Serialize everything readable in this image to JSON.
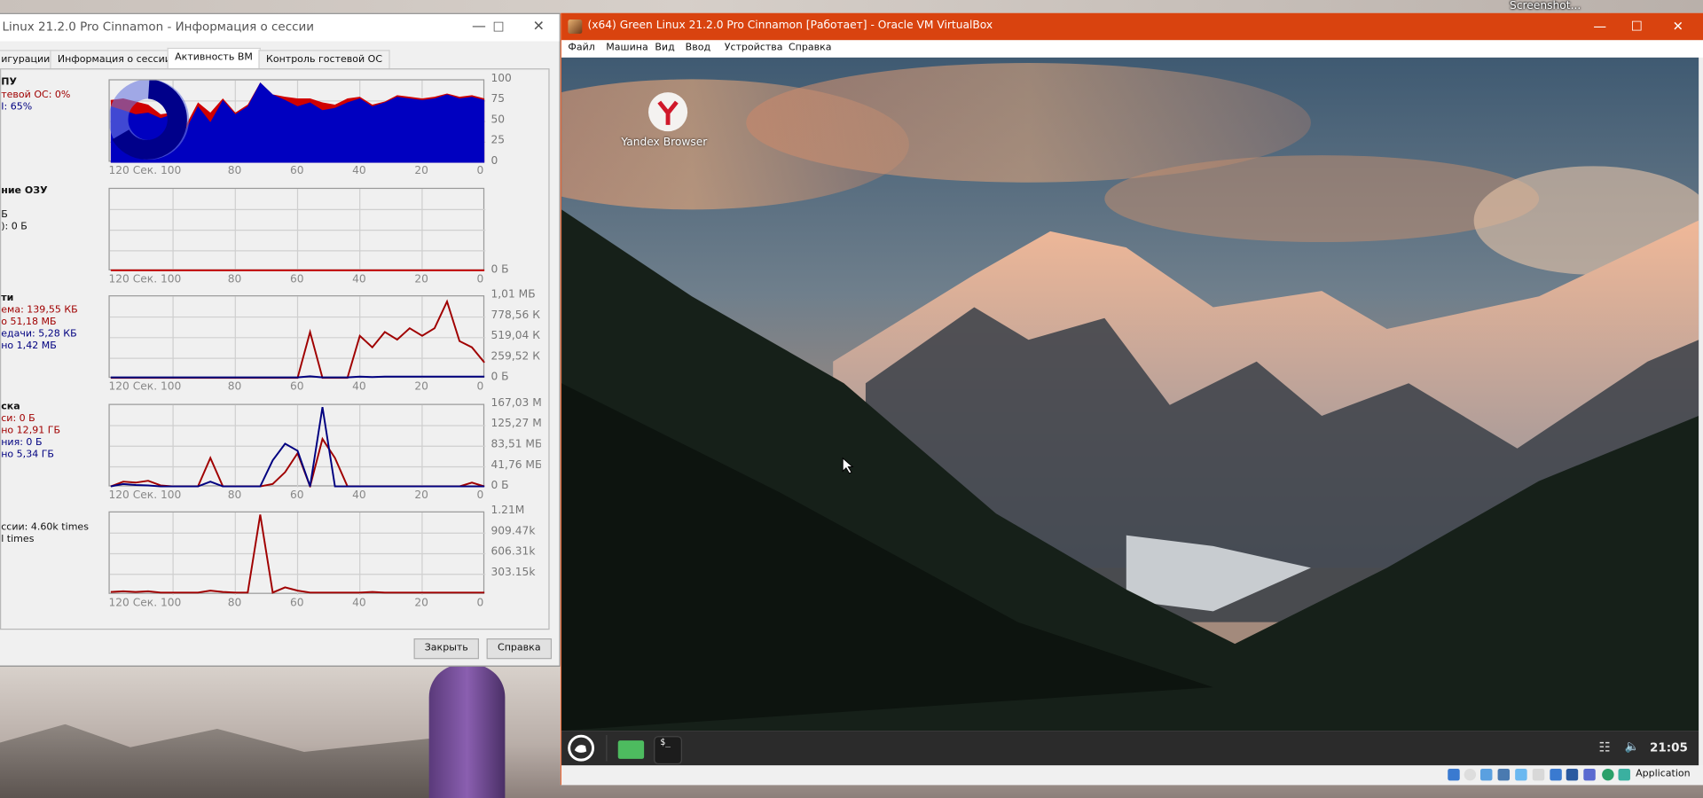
{
  "desktop": {
    "screenshot_label": "Screenshot..."
  },
  "dialog": {
    "title": "Linux 21.2.0 Pro Cinnamon - Информация о сессии",
    "tabs": [
      {
        "label": "игурации",
        "active": false
      },
      {
        "label": "Информация о сессии",
        "active": false
      },
      {
        "label": "Активность ВМ",
        "active": true
      },
      {
        "label": "Контроль гостевой ОС",
        "active": false
      }
    ],
    "sections": [
      {
        "heading": "ПУ",
        "lines": [
          {
            "text": "тевой ОС: 0%",
            "color": "#a00000"
          },
          {
            "text": "І: 65%",
            "color": "#000080"
          }
        ]
      },
      {
        "heading": "ние ОЗУ",
        "lines": [
          {
            "text": "Б",
            "color": "#111111"
          },
          {
            "text": "): 0 Б",
            "color": "#111111"
          }
        ]
      },
      {
        "heading": "ти",
        "lines": [
          {
            "text": "ема: 139,55 КБ",
            "color": "#a00000"
          },
          {
            "text": "о 51,18 МБ",
            "color": "#a00000"
          },
          {
            "text": "едачи: 5,28 КБ",
            "color": "#000080"
          },
          {
            "text": "но 1,42 МБ",
            "color": "#000080"
          }
        ]
      },
      {
        "heading": "ска",
        "lines": [
          {
            "text": "си: 0 Б",
            "color": "#a00000"
          },
          {
            "text": "но 12,91 ГБ",
            "color": "#a00000"
          },
          {
            "text": "ния: 0 Б",
            "color": "#000080"
          },
          {
            "text": "но 5,34 ГБ",
            "color": "#000080"
          }
        ]
      },
      {
        "heading": "",
        "lines": [
          {
            "text": "ссии: 4.60k times",
            "color": "#111111"
          },
          {
            "text": "l times",
            "color": "#111111"
          }
        ]
      }
    ],
    "close_label": "Закрыть",
    "help_label": "Справка"
  },
  "chart_data": [
    {
      "type": "area",
      "xlim": [
        120,
        0
      ],
      "ylim": [
        0,
        100
      ],
      "grid": true,
      "x": [
        120,
        116,
        112,
        108,
        104,
        100,
        96,
        92,
        88,
        84,
        80,
        76,
        72,
        68,
        64,
        60,
        56,
        52,
        48,
        44,
        40,
        36,
        32,
        28,
        24,
        20,
        16,
        12,
        8,
        4,
        0
      ],
      "x_ticks": [
        "120 Сек. 100",
        "80",
        "60",
        "40",
        "20",
        "0"
      ],
      "y_ticks": [
        "100",
        "75",
        "50",
        "25",
        "0"
      ],
      "series": [
        {
          "color": "#d00000",
          "values": [
            78,
            80,
            76,
            72,
            60,
            62,
            45,
            75,
            62,
            80,
            62,
            72,
            100,
            85,
            82,
            80,
            80,
            75,
            72,
            80,
            82,
            72,
            76,
            84,
            82,
            80,
            82,
            86,
            82,
            84,
            80
          ]
        },
        {
          "color": "#0000c0",
          "values": [
            70,
            65,
            60,
            62,
            55,
            60,
            40,
            70,
            50,
            78,
            60,
            70,
            100,
            85,
            78,
            70,
            75,
            65,
            68,
            75,
            80,
            70,
            75,
            82,
            80,
            78,
            80,
            85,
            80,
            82,
            78
          ]
        }
      ]
    },
    {
      "type": "line",
      "xlim": [
        120,
        0
      ],
      "ylim": [
        0,
        1
      ],
      "grid": true,
      "x": [
        120,
        0
      ],
      "x_ticks": [
        "120 Сек. 100",
        "80",
        "60",
        "40",
        "20",
        "0"
      ],
      "y_ticks": [
        "0 Б"
      ],
      "series": [
        {
          "color": "#c00000",
          "values": [
            0,
            0
          ]
        }
      ]
    },
    {
      "type": "line",
      "xlim": [
        120,
        0
      ],
      "ylim": [
        0,
        1038
      ],
      "grid": true,
      "x": [
        120,
        116,
        112,
        108,
        104,
        100,
        96,
        92,
        88,
        84,
        80,
        76,
        72,
        68,
        64,
        60,
        56,
        52,
        48,
        44,
        40,
        36,
        32,
        28,
        24,
        20,
        16,
        12,
        8,
        4,
        0
      ],
      "x_ticks": [
        "120 Сек. 100",
        "80",
        "60",
        "40",
        "20",
        "0"
      ],
      "y_ticks": [
        "1,01 МБ",
        "778,56 К",
        "519,04 К",
        "259,52 К",
        "0 Б"
      ],
      "series": [
        {
          "color": "#a00000",
          "values": [
            0,
            0,
            0,
            0,
            0,
            0,
            0,
            0,
            0,
            0,
            0,
            0,
            0,
            0,
            0,
            0,
            600,
            0,
            0,
            0,
            550,
            400,
            600,
            500,
            650,
            550,
            650,
            1000,
            480,
            400,
            200
          ]
        },
        {
          "color": "#000080",
          "values": [
            5,
            5,
            5,
            5,
            5,
            5,
            5,
            5,
            5,
            5,
            5,
            5,
            5,
            5,
            5,
            5,
            20,
            5,
            5,
            5,
            15,
            10,
            15,
            15,
            15,
            15,
            15,
            15,
            15,
            15,
            15
          ]
        }
      ]
    },
    {
      "type": "line",
      "xlim": [
        120,
        0
      ],
      "ylim": [
        0,
        167.03
      ],
      "grid": true,
      "x": [
        120,
        116,
        112,
        108,
        104,
        100,
        96,
        92,
        88,
        84,
        80,
        76,
        72,
        68,
        64,
        60,
        56,
        52,
        48,
        44,
        40,
        36,
        32,
        28,
        24,
        20,
        16,
        12,
        8,
        4,
        0
      ],
      "x_ticks": [
        "120 Сек. 100",
        "80",
        "60",
        "40",
        "20",
        "0"
      ],
      "y_ticks": [
        "167,03 М",
        "125,27 М",
        "83,51 МБ",
        "41,76 МБ",
        "0 Б"
      ],
      "series": [
        {
          "color": "#a00000",
          "values": [
            0,
            10,
            8,
            12,
            2,
            0,
            0,
            0,
            60,
            0,
            0,
            0,
            0,
            5,
            30,
            70,
            0,
            100,
            60,
            0,
            0,
            0,
            0,
            0,
            0,
            0,
            0,
            0,
            0,
            8,
            0
          ]
        },
        {
          "color": "#000080",
          "values": [
            0,
            5,
            3,
            2,
            0,
            0,
            0,
            0,
            10,
            0,
            0,
            0,
            0,
            55,
            90,
            75,
            0,
            167,
            0,
            0,
            0,
            0,
            0,
            0,
            0,
            0,
            0,
            0,
            0,
            0,
            0
          ]
        }
      ]
    },
    {
      "type": "line",
      "xlim": [
        120,
        0
      ],
      "ylim": [
        0,
        1210
      ],
      "grid": true,
      "x": [
        120,
        116,
        112,
        108,
        104,
        100,
        96,
        92,
        88,
        84,
        80,
        76,
        72,
        68,
        64,
        60,
        56,
        52,
        48,
        44,
        40,
        36,
        32,
        28,
        24,
        20,
        16,
        12,
        8,
        4,
        0
      ],
      "x_ticks": [
        "120 Сек. 100",
        "80",
        "60",
        "40",
        "20",
        "0"
      ],
      "y_ticks": [
        "1.21M",
        "909.47k",
        "606.31k",
        "303.15k"
      ],
      "series": [
        {
          "color": "#a00000",
          "values": [
            30,
            40,
            30,
            40,
            20,
            20,
            20,
            20,
            50,
            30,
            20,
            20,
            1210,
            20,
            100,
            50,
            20,
            20,
            20,
            20,
            20,
            30,
            20,
            20,
            20,
            20,
            20,
            20,
            20,
            20,
            20
          ]
        }
      ]
    }
  ],
  "vbox": {
    "title": "(x64) Green Linux 21.2.0 Pro Cinnamon [Работает] - Oracle VM VirtualBox",
    "menu": [
      "Файл",
      "Машина",
      "Вид",
      "Ввод",
      "Устройства",
      "Справка"
    ],
    "accent": "#d9430f",
    "desktop_icon_label": "Yandex Browser",
    "clock": "21:05",
    "status_text": "Application"
  }
}
